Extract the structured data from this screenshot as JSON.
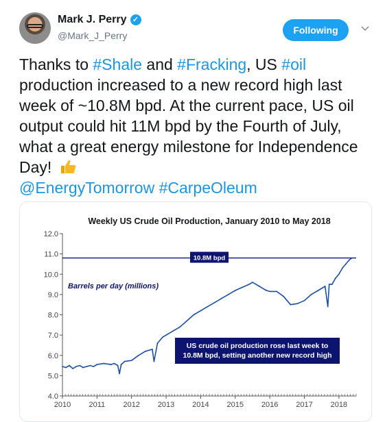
{
  "header": {
    "display_name": "Mark J. Perry",
    "handle": "@Mark_J_Perry",
    "follow_label": "Following",
    "accent": "#1da1f2"
  },
  "tweet": {
    "t1": "Thanks to ",
    "h1": "#Shale",
    "t2": " and ",
    "h2": "#Fracking",
    "t3": ", US ",
    "h3": "#oil",
    "t4": " production increased to a new record high last week of ~10.8M bpd. At the current pace, US oil output could hit 11M bpd by the Fourth of July, what a great energy milestone for Independence Day! ",
    "emoji": "thumbs-up-icon",
    "m1": "@EnergyTomorrow",
    "h4": "#CarpeOleum",
    "link_color": "#1b95e0"
  },
  "chart_data": {
    "type": "line",
    "title": "Weekly US Crude Oil Production, January 2010 to May 2018",
    "ylabel": "Barrels per day (millions)",
    "xlabel": "",
    "ylim": [
      4.0,
      12.0
    ],
    "xlim": [
      2010.0,
      2018.5
    ],
    "yticks": [
      "12.0",
      "11.0",
      "10.0",
      "9.0",
      "8.0",
      "7.0",
      "6.0",
      "5.0",
      "4.0"
    ],
    "xticks": [
      "2010",
      "2011",
      "2012",
      "2013",
      "2014",
      "2015",
      "2016",
      "2017",
      "2018"
    ],
    "reference_line": {
      "value": 10.8,
      "label": "10.8M bpd"
    },
    "annotation": [
      "US crude oil production rose last week to",
      "10.8M bpd, setting another new record high"
    ],
    "grid": false,
    "series": [
      {
        "color": "#1c4fa0",
        "x": [
          2010.0,
          2010.1,
          2010.2,
          2010.3,
          2010.4,
          2010.5,
          2010.6,
          2010.7,
          2010.8,
          2010.9,
          2011.0,
          2011.2,
          2011.4,
          2011.5,
          2011.6,
          2011.65,
          2011.7,
          2011.8,
          2012.0,
          2012.2,
          2012.4,
          2012.6,
          2012.65,
          2012.75,
          2012.9,
          2013.0,
          2013.2,
          2013.4,
          2013.6,
          2013.8,
          2014.0,
          2014.2,
          2014.4,
          2014.6,
          2014.8,
          2015.0,
          2015.2,
          2015.4,
          2015.5,
          2015.7,
          2015.9,
          2016.0,
          2016.2,
          2016.4,
          2016.6,
          2016.8,
          2017.0,
          2017.2,
          2017.4,
          2017.6,
          2017.68,
          2017.72,
          2017.8,
          2017.9,
          2018.0,
          2018.1,
          2018.2,
          2018.3,
          2018.38
        ],
        "values": [
          5.45,
          5.4,
          5.5,
          5.35,
          5.45,
          5.5,
          5.4,
          5.45,
          5.5,
          5.45,
          5.55,
          5.6,
          5.55,
          5.6,
          5.5,
          5.1,
          5.55,
          5.7,
          5.75,
          6.0,
          6.2,
          6.3,
          5.7,
          6.6,
          6.9,
          7.0,
          7.2,
          7.4,
          7.7,
          8.0,
          8.2,
          8.4,
          8.6,
          8.8,
          9.0,
          9.2,
          9.35,
          9.5,
          9.6,
          9.4,
          9.2,
          9.15,
          9.15,
          8.9,
          8.5,
          8.55,
          8.7,
          9.0,
          9.2,
          9.4,
          8.4,
          9.5,
          9.5,
          9.8,
          10.0,
          10.3,
          10.5,
          10.7,
          10.8
        ]
      }
    ],
    "annotation_bg": "#0d1470",
    "title_color": "#14171a"
  }
}
